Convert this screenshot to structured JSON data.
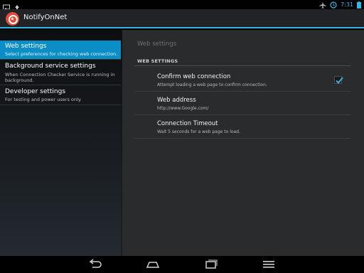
{
  "status_bar": {
    "time": "7:31",
    "icons": [
      "picture-icon",
      "upload-icon",
      "airplane-mode-icon",
      "clock-icon",
      "battery-icon"
    ]
  },
  "app": {
    "title": "NotifyOnNet",
    "accent_color": "#33b5e5"
  },
  "headers": [
    {
      "title": "Web settings",
      "summary": "Select preferences for checking web connection."
    },
    {
      "title": "Background service settings",
      "summary": "When Connection Checker Service is running in background."
    },
    {
      "title": "Developer settings",
      "summary": "For testing and power users only."
    }
  ],
  "detail": {
    "breadcrumb": "Web settings",
    "category": "WEB SETTINGS",
    "prefs": [
      {
        "title": "Confirm web connection",
        "summary": "Attempt loading a web page to confirm connection.",
        "checked": true
      },
      {
        "title": "Web address",
        "summary": "http://www.Google.com/"
      },
      {
        "title": "Connection Timeout",
        "summary": "Wait 5 seconds for a web page to load."
      }
    ]
  },
  "nav_bar": {
    "buttons": [
      "back-icon",
      "home-icon",
      "recents-icon",
      "menu-icon"
    ]
  }
}
